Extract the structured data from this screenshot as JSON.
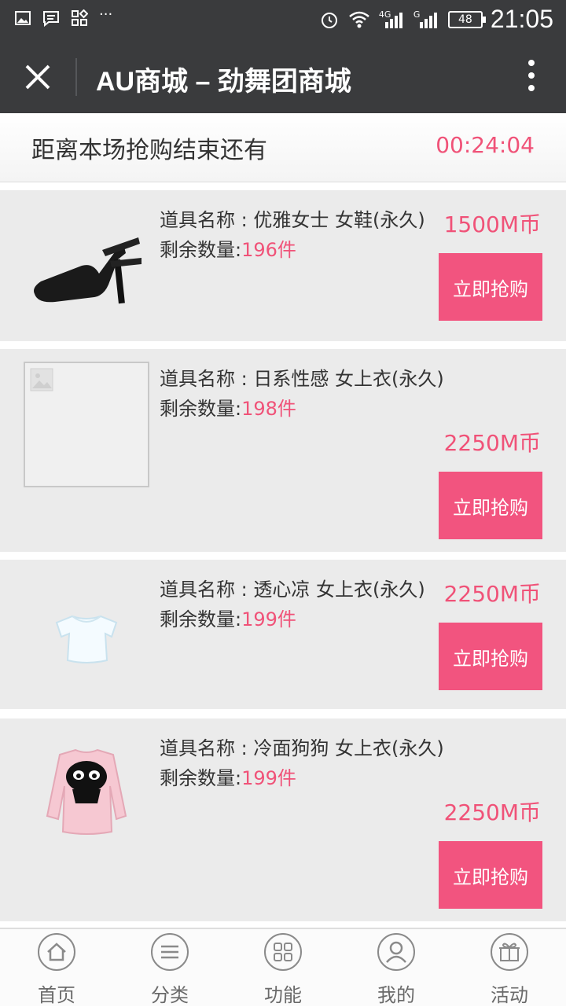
{
  "status_bar": {
    "time": "21:05",
    "battery": "48",
    "network1": "4G",
    "network2": "G"
  },
  "app_bar": {
    "title": "AU商城 – 劲舞团商城"
  },
  "countdown": {
    "label": "距离本场抢购结束还有",
    "time": "00:24:04"
  },
  "items": [
    {
      "name": "道具名称 : 优雅女士 女鞋(永久)",
      "qty_label": "剩余数量:",
      "qty": "196件",
      "price": "1500M币",
      "buy": "立即抢购",
      "icon": "shoe-image"
    },
    {
      "name": "道具名称 : 日系性感 女上衣(永久)",
      "qty_label": "剩余数量:",
      "qty": "198件",
      "price": "2250M币",
      "buy": "立即抢购",
      "icon": "image-placeholder"
    },
    {
      "name": "道具名称 : 透心凉 女上衣(永久)",
      "qty_label": "剩余数量:",
      "qty": "199件",
      "price": "2250M币",
      "buy": "立即抢购",
      "icon": "white-top-image"
    },
    {
      "name": "道具名称 : 冷面狗狗 女上衣(永久)",
      "qty_label": "剩余数量:",
      "qty": "199件",
      "price": "2250M币",
      "buy": "立即抢购",
      "icon": "pink-sweater-image"
    }
  ],
  "tabbar": [
    {
      "label": "首页",
      "icon": "home-icon"
    },
    {
      "label": "分类",
      "icon": "list-icon"
    },
    {
      "label": "功能",
      "icon": "grid-icon"
    },
    {
      "label": "我的",
      "icon": "user-icon"
    },
    {
      "label": "活动",
      "icon": "gift-icon"
    }
  ],
  "colors": {
    "accent": "#f05278",
    "button": "#f2547f",
    "bar": "#3a3b3d"
  }
}
